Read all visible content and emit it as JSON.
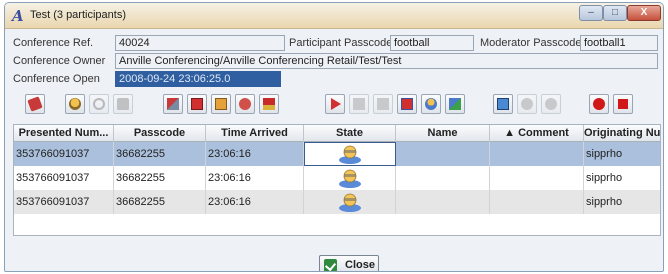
{
  "window": {
    "title": "Test (3 participants)",
    "controls": {
      "minimize": "–",
      "maximize": "□",
      "close": "X"
    }
  },
  "form": {
    "conference_ref_label": "Conference Ref.",
    "conference_ref": "40024",
    "participant_passcode_label": "Participant Passcode",
    "participant_passcode": "football",
    "moderator_passcode_label": "Moderator Passcode",
    "moderator_passcode": "football1",
    "conference_owner_label": "Conference Owner",
    "conference_owner": "Anville Conferencing/Anville Conferencing Retail/Test/Test",
    "conference_open_label": "Conference Open",
    "conference_open": "2008-09-24 23:06:25.0"
  },
  "toolbar": {
    "buttons": [
      {
        "icon": "eraser-icon",
        "enabled": true
      },
      {
        "icon": "operator-icon",
        "enabled": true
      },
      {
        "icon": "search-icon",
        "enabled": false
      },
      {
        "icon": "lock-icon",
        "enabled": false
      },
      {
        "icon": "phone-icon",
        "enabled": true
      },
      {
        "icon": "remove-icon",
        "enabled": true
      },
      {
        "icon": "window-icon",
        "enabled": true
      },
      {
        "icon": "record-icon",
        "enabled": true
      },
      {
        "icon": "flag-icon",
        "enabled": true
      },
      {
        "icon": "arrow-right-icon",
        "enabled": true
      },
      {
        "icon": "doc-icon",
        "enabled": false
      },
      {
        "icon": "doc-arrow-icon",
        "enabled": false
      },
      {
        "icon": "delete-icon",
        "enabled": true
      },
      {
        "icon": "users-icon",
        "enabled": true
      },
      {
        "icon": "export-icon",
        "enabled": true
      },
      {
        "icon": "monitor-icon",
        "enabled": true
      },
      {
        "icon": "globe-icon",
        "enabled": false
      },
      {
        "icon": "globe2-icon",
        "enabled": false
      },
      {
        "icon": "record-dot-icon",
        "enabled": true
      },
      {
        "icon": "stop-icon",
        "enabled": true
      }
    ]
  },
  "table": {
    "columns": [
      {
        "label": "Presented Num..."
      },
      {
        "label": "Passcode"
      },
      {
        "label": "Time Arrived"
      },
      {
        "label": "State"
      },
      {
        "label": "Name"
      },
      {
        "label": "▲ Comment"
      },
      {
        "label": "Originating Nu..."
      }
    ],
    "rows": [
      {
        "presented": "353766091037",
        "passcode": "36682255",
        "time": "23:06:16",
        "state": "participant-icon",
        "name": "",
        "comment": "",
        "originating": "sipprho"
      },
      {
        "presented": "353766091037",
        "passcode": "36682255",
        "time": "23:06:16",
        "state": "participant-icon",
        "name": "",
        "comment": "",
        "originating": "sipprho"
      },
      {
        "presented": "353766091037",
        "passcode": "36682255",
        "time": "23:06:16",
        "state": "participant-icon",
        "name": "",
        "comment": "",
        "originating": "sipprho"
      }
    ]
  },
  "footer": {
    "close_label": "Close"
  }
}
